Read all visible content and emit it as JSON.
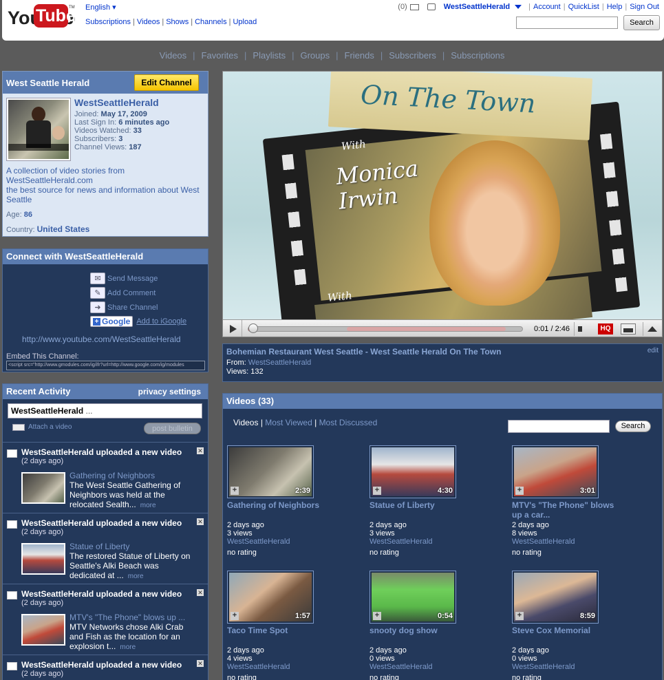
{
  "header": {
    "logo_text": "YouTube",
    "logo_tm": "TM",
    "language": "English ▾",
    "nav": [
      "Subscriptions",
      "Videos",
      "Shows",
      "Channels",
      "Upload"
    ],
    "inbox_count": "(0)",
    "username": "WestSeattleHerald",
    "links": [
      "Account",
      "QuickList",
      "Help",
      "Sign Out"
    ],
    "search_value": "",
    "search_button": "Search"
  },
  "channel_nav": [
    "Videos",
    "Favorites",
    "Playlists",
    "Groups",
    "Friends",
    "Subscribers",
    "Subscriptions"
  ],
  "profile": {
    "title": "West Seattle Herald",
    "edit_button": "Edit Channel",
    "name": "WestSeattleHerald",
    "joined_label": "Joined:",
    "joined": "May 17, 2009",
    "signin_label": "Last Sign In:",
    "signin": "6 minutes ago",
    "watched_label": "Videos Watched:",
    "watched": "33",
    "subs_label": "Subscribers:",
    "subs": "3",
    "views_label": "Channel Views:",
    "views": "187",
    "desc1": "A collection of video stories from WestSeattleHerald.com",
    "desc2": "the best source for news and information about West Seattle",
    "age_label": "Age:",
    "age": "86",
    "country_label": "Country:",
    "country": "United States"
  },
  "connect": {
    "title": "Connect with WestSeattleHerald",
    "send": "Send Message",
    "comment": "Add Comment",
    "share": "Share Channel",
    "google": "Google",
    "igoogle": "Add to iGoogle",
    "url": "http://www.youtube.com/WestSeattleHerald",
    "embed_label": "Embed This Channel:",
    "embed_code": "<script src=\"http://www.gmodules.com/ig/ifr?url=http://www.google.com/ig/modules"
  },
  "activity": {
    "title": "Recent Activity",
    "privacy": "privacy settings",
    "bulletin_user": "WestSeattleHerald",
    "bulletin_rest": "...",
    "attach": "Attach a video",
    "post": "post bulletin",
    "items": [
      {
        "title": "WestSeattleHerald uploaded a new video",
        "ago": "(2 days ago)",
        "video": "Gathering of Neighbors",
        "desc": "The West Seattle Gathering of Neighbors was held at the relocated Sealth...",
        "more": "more"
      },
      {
        "title": "WestSeattleHerald uploaded a new video",
        "ago": "(2 days ago)",
        "video": "Statue of Liberty",
        "desc": "The restored Statue of Liberty on Seattle's Alki Beach was dedicated at ...",
        "more": "more"
      },
      {
        "title": "WestSeattleHerald uploaded a new video",
        "ago": "(2 days ago)",
        "video": "MTV's \"The Phone\" blows up ...",
        "desc": "MTV Networks chose Alki Crab and Fish as the location for an explosion t...",
        "more": "more"
      },
      {
        "title": "WestSeattleHerald uploaded a new video",
        "ago": "(2 days ago)"
      }
    ]
  },
  "player": {
    "overlay_title": "On The Town",
    "with1": "With",
    "host": "Monica Irwin",
    "with2": "With",
    "time": "0:01 / 2:46",
    "hq": "HQ",
    "progress": 0.01
  },
  "video_info": {
    "title": "Bohemian Restaurant West Seattle - West Seattle Herald On The Town",
    "edit": "edit",
    "from_label": "From:",
    "from": "WestSeattleHerald",
    "views": "Views: 132"
  },
  "videos": {
    "title": "Videos (33)",
    "tab_active": "Videos",
    "tab_viewed": "Most Viewed",
    "tab_discussed": "Most Discussed",
    "search_button": "Search",
    "items": [
      {
        "title": "Gathering of Neighbors",
        "dur": "2:39",
        "ago": "2 days ago",
        "views": "3 views",
        "author": "WestSeattleHerald",
        "rating": "no rating"
      },
      {
        "title": "Statue of Liberty",
        "dur": "4:30",
        "ago": "2 days ago",
        "views": "3 views",
        "author": "WestSeattleHerald",
        "rating": "no rating"
      },
      {
        "title": "MTV's \"The Phone\" blows up a car...",
        "dur": "3:01",
        "ago": "2 days ago",
        "views": "8 views",
        "author": "WestSeattleHerald",
        "rating": "no rating"
      },
      {
        "title": "Taco Time Spot",
        "dur": "1:57",
        "ago": "2 days ago",
        "views": "4 views",
        "author": "WestSeattleHerald",
        "rating": "no rating"
      },
      {
        "title": "snooty dog show",
        "dur": "0:54",
        "ago": "2 days ago",
        "views": "0 views",
        "author": "WestSeattleHerald",
        "rating": "no rating"
      },
      {
        "title": "Steve Cox Memorial",
        "dur": "8:59",
        "ago": "2 days ago",
        "views": "0 views",
        "author": "WestSeattleHerald",
        "rating": "no rating"
      }
    ]
  },
  "colors": {
    "accent": "#0033cc",
    "panel": "#23385a",
    "panel_head": "#5a7bb0",
    "edit_btn": "#f5c400",
    "hq": "#cc0000"
  }
}
